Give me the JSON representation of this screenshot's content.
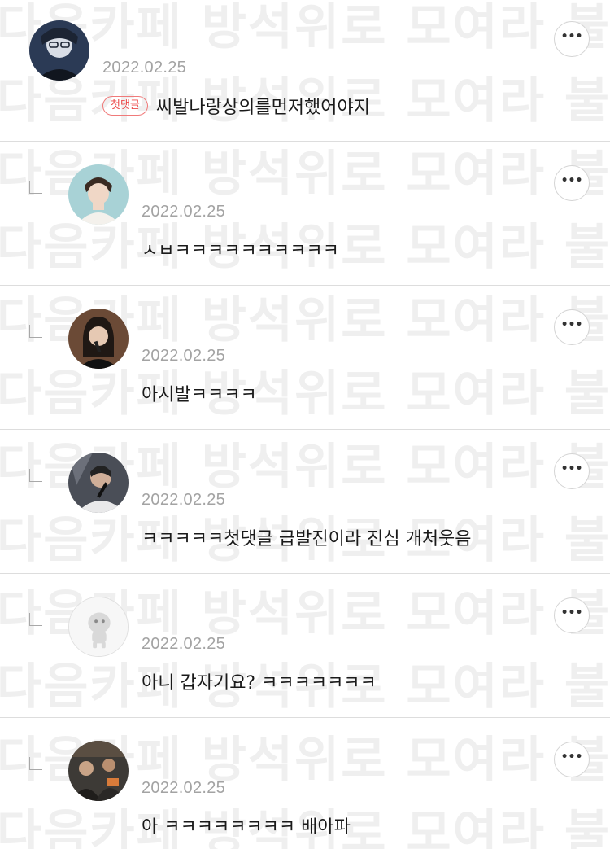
{
  "watermark": {
    "text": "다음카페 방석위로 모여라 불펌금지"
  },
  "more_icon_glyph": "•••",
  "comments": [
    {
      "avatar": "avatar-man-glasses-illustration",
      "date": "2022.02.25",
      "badge": "첫댓글",
      "text": "씨발나랑상의를먼저했어야지",
      "is_reply": false
    },
    {
      "avatar": "avatar-man-white-sweater",
      "date": "2022.02.25",
      "text": "ㅅㅂㅋㅋㅋㅋㅋㅋㅋㅋㅋㅋ",
      "is_reply": true
    },
    {
      "avatar": "avatar-woman-microphone",
      "date": "2022.02.25",
      "text": "아시발ㅋㅋㅋㅋ",
      "is_reply": true
    },
    {
      "avatar": "avatar-singer-stage",
      "date": "2022.02.25",
      "text": "ㅋㅋㅋㅋㅋ첫댓글 급발진이라 진심 개처웃음",
      "is_reply": true
    },
    {
      "avatar": "avatar-default-character",
      "date": "2022.02.25",
      "text": "아니 갑자기요? ㅋㅋㅋㅋㅋㅋㅋ",
      "is_reply": true
    },
    {
      "avatar": "avatar-group-photo",
      "date": "2022.02.25",
      "text": "아 ㅋㅋㅋㅋㅋㅋㅋㅋ 배아파",
      "is_reply": true
    }
  ]
}
